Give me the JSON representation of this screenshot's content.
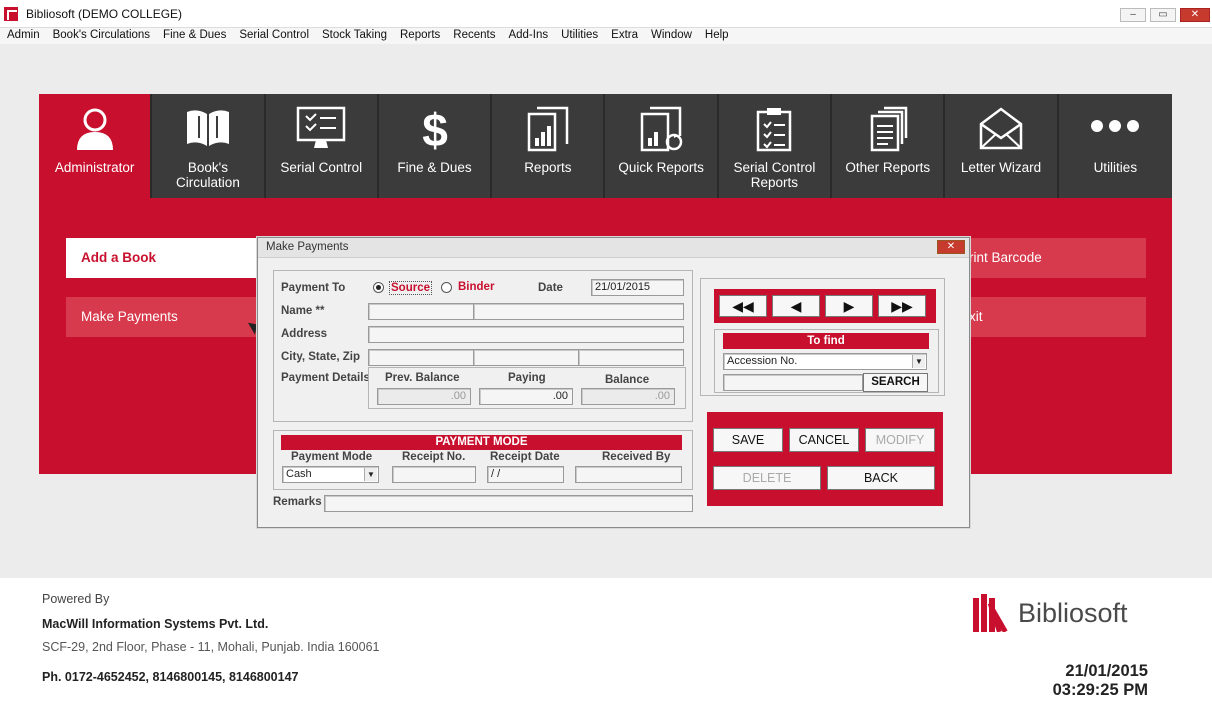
{
  "window": {
    "title": "Bibliosoft  (DEMO COLLEGE)"
  },
  "menubar": [
    "Admin",
    "Book's Circulations",
    "Fine & Dues",
    "Serial Control",
    "Stock Taking",
    "Reports",
    "Recents",
    "Add-Ins",
    "Utilities",
    "Extra",
    "Window",
    "Help"
  ],
  "tiles": [
    {
      "label": "Administrator",
      "icon": "user-icon",
      "active": true
    },
    {
      "label": "Book's Circulation",
      "icon": "book-icon"
    },
    {
      "label": "Serial Control",
      "icon": "monitor-icon"
    },
    {
      "label": "Fine & Dues",
      "icon": "dollar-icon"
    },
    {
      "label": "Reports",
      "icon": "report-chart-icon"
    },
    {
      "label": "Quick Reports",
      "icon": "quick-report-icon"
    },
    {
      "label": "Serial Control Reports",
      "icon": "clipboard-icon"
    },
    {
      "label": "Other Reports",
      "icon": "documents-icon"
    },
    {
      "label": "Letter Wizard",
      "icon": "envelope-icon"
    },
    {
      "label": "Utilities",
      "icon": "dots-icon"
    }
  ],
  "admin_menu": {
    "add_book": "Add a Book",
    "make_payments": "Make Payments",
    "print_barcode": "rint Barcode",
    "exit": "xit"
  },
  "dialog": {
    "title": "Make Payments",
    "payment_to_label": "Payment To",
    "source_label": "Source",
    "binder_label": "Binder",
    "date_label": "Date",
    "date_value": "21/01/2015",
    "name_label": "Name **",
    "address_label": "Address",
    "city_label": "City, State, Zip",
    "payment_details_label": "Payment Details",
    "prev_balance_label": "Prev. Balance",
    "paying_label": "Paying",
    "balance_label": "Balance",
    "prev_balance_value": ".00",
    "paying_value": ".00",
    "balance_value": ".00",
    "payment_mode_header": "PAYMENT MODE",
    "payment_mode_label": "Payment Mode",
    "receipt_no_label": "Receipt No.",
    "receipt_date_label": "Receipt Date",
    "received_by_label": "Received By",
    "payment_mode_value": "Cash",
    "receipt_date_value": " / /",
    "remarks_label": "Remarks",
    "to_find_label": "To find",
    "find_field_value": "Accession No.",
    "search_button": "SEARCH",
    "save_button": "SAVE",
    "cancel_button": "CANCEL",
    "modify_button": "MODIFY",
    "delete_button": "DELETE",
    "back_button": "BACK",
    "nav": [
      "◀◀",
      "◀",
      "▶",
      "▶▶"
    ]
  },
  "footer": {
    "powered_by": "Powered By",
    "company": "MacWill Information Systems Pvt. Ltd.",
    "address": "SCF-29, 2nd Floor, Phase - 11, Mohali, Punjab. India 160061",
    "phone": "Ph. 0172-4652452, 8146800145, 8146800147",
    "logo_text": "Bibliosoft",
    "date": "21/01/2015",
    "time": "03:29:25 PM"
  },
  "colors": {
    "brand": "#c8102e",
    "tile_dark": "#3b3b3b"
  }
}
